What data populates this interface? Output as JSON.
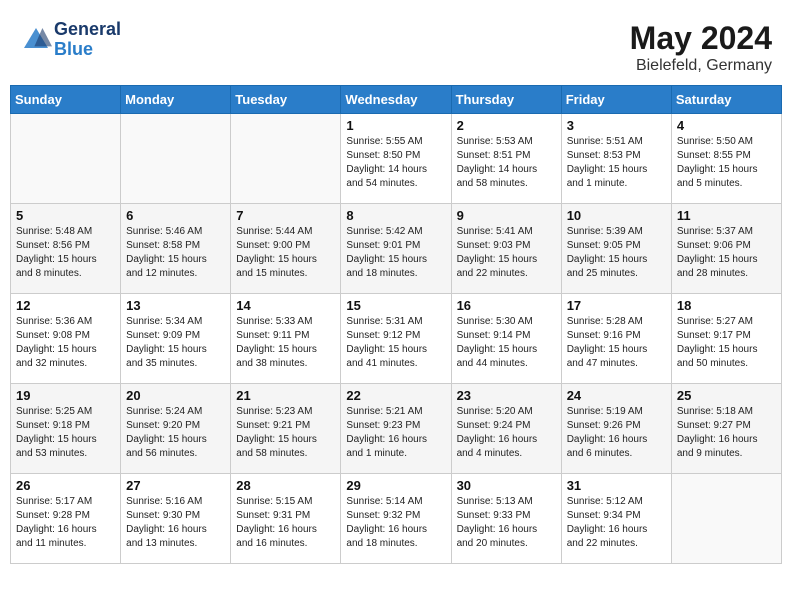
{
  "header": {
    "logo_line1": "General",
    "logo_line2": "Blue",
    "month_year": "May 2024",
    "location": "Bielefeld, Germany"
  },
  "weekdays": [
    "Sunday",
    "Monday",
    "Tuesday",
    "Wednesday",
    "Thursday",
    "Friday",
    "Saturday"
  ],
  "weeks": [
    [
      {
        "day": "",
        "content": ""
      },
      {
        "day": "",
        "content": ""
      },
      {
        "day": "",
        "content": ""
      },
      {
        "day": "1",
        "content": "Sunrise: 5:55 AM\nSunset: 8:50 PM\nDaylight: 14 hours\nand 54 minutes."
      },
      {
        "day": "2",
        "content": "Sunrise: 5:53 AM\nSunset: 8:51 PM\nDaylight: 14 hours\nand 58 minutes."
      },
      {
        "day": "3",
        "content": "Sunrise: 5:51 AM\nSunset: 8:53 PM\nDaylight: 15 hours\nand 1 minute."
      },
      {
        "day": "4",
        "content": "Sunrise: 5:50 AM\nSunset: 8:55 PM\nDaylight: 15 hours\nand 5 minutes."
      }
    ],
    [
      {
        "day": "5",
        "content": "Sunrise: 5:48 AM\nSunset: 8:56 PM\nDaylight: 15 hours\nand 8 minutes."
      },
      {
        "day": "6",
        "content": "Sunrise: 5:46 AM\nSunset: 8:58 PM\nDaylight: 15 hours\nand 12 minutes."
      },
      {
        "day": "7",
        "content": "Sunrise: 5:44 AM\nSunset: 9:00 PM\nDaylight: 15 hours\nand 15 minutes."
      },
      {
        "day": "8",
        "content": "Sunrise: 5:42 AM\nSunset: 9:01 PM\nDaylight: 15 hours\nand 18 minutes."
      },
      {
        "day": "9",
        "content": "Sunrise: 5:41 AM\nSunset: 9:03 PM\nDaylight: 15 hours\nand 22 minutes."
      },
      {
        "day": "10",
        "content": "Sunrise: 5:39 AM\nSunset: 9:05 PM\nDaylight: 15 hours\nand 25 minutes."
      },
      {
        "day": "11",
        "content": "Sunrise: 5:37 AM\nSunset: 9:06 PM\nDaylight: 15 hours\nand 28 minutes."
      }
    ],
    [
      {
        "day": "12",
        "content": "Sunrise: 5:36 AM\nSunset: 9:08 PM\nDaylight: 15 hours\nand 32 minutes."
      },
      {
        "day": "13",
        "content": "Sunrise: 5:34 AM\nSunset: 9:09 PM\nDaylight: 15 hours\nand 35 minutes."
      },
      {
        "day": "14",
        "content": "Sunrise: 5:33 AM\nSunset: 9:11 PM\nDaylight: 15 hours\nand 38 minutes."
      },
      {
        "day": "15",
        "content": "Sunrise: 5:31 AM\nSunset: 9:12 PM\nDaylight: 15 hours\nand 41 minutes."
      },
      {
        "day": "16",
        "content": "Sunrise: 5:30 AM\nSunset: 9:14 PM\nDaylight: 15 hours\nand 44 minutes."
      },
      {
        "day": "17",
        "content": "Sunrise: 5:28 AM\nSunset: 9:16 PM\nDaylight: 15 hours\nand 47 minutes."
      },
      {
        "day": "18",
        "content": "Sunrise: 5:27 AM\nSunset: 9:17 PM\nDaylight: 15 hours\nand 50 minutes."
      }
    ],
    [
      {
        "day": "19",
        "content": "Sunrise: 5:25 AM\nSunset: 9:18 PM\nDaylight: 15 hours\nand 53 minutes."
      },
      {
        "day": "20",
        "content": "Sunrise: 5:24 AM\nSunset: 9:20 PM\nDaylight: 15 hours\nand 56 minutes."
      },
      {
        "day": "21",
        "content": "Sunrise: 5:23 AM\nSunset: 9:21 PM\nDaylight: 15 hours\nand 58 minutes."
      },
      {
        "day": "22",
        "content": "Sunrise: 5:21 AM\nSunset: 9:23 PM\nDaylight: 16 hours\nand 1 minute."
      },
      {
        "day": "23",
        "content": "Sunrise: 5:20 AM\nSunset: 9:24 PM\nDaylight: 16 hours\nand 4 minutes."
      },
      {
        "day": "24",
        "content": "Sunrise: 5:19 AM\nSunset: 9:26 PM\nDaylight: 16 hours\nand 6 minutes."
      },
      {
        "day": "25",
        "content": "Sunrise: 5:18 AM\nSunset: 9:27 PM\nDaylight: 16 hours\nand 9 minutes."
      }
    ],
    [
      {
        "day": "26",
        "content": "Sunrise: 5:17 AM\nSunset: 9:28 PM\nDaylight: 16 hours\nand 11 minutes."
      },
      {
        "day": "27",
        "content": "Sunrise: 5:16 AM\nSunset: 9:30 PM\nDaylight: 16 hours\nand 13 minutes."
      },
      {
        "day": "28",
        "content": "Sunrise: 5:15 AM\nSunset: 9:31 PM\nDaylight: 16 hours\nand 16 minutes."
      },
      {
        "day": "29",
        "content": "Sunrise: 5:14 AM\nSunset: 9:32 PM\nDaylight: 16 hours\nand 18 minutes."
      },
      {
        "day": "30",
        "content": "Sunrise: 5:13 AM\nSunset: 9:33 PM\nDaylight: 16 hours\nand 20 minutes."
      },
      {
        "day": "31",
        "content": "Sunrise: 5:12 AM\nSunset: 9:34 PM\nDaylight: 16 hours\nand 22 minutes."
      },
      {
        "day": "",
        "content": ""
      }
    ]
  ]
}
